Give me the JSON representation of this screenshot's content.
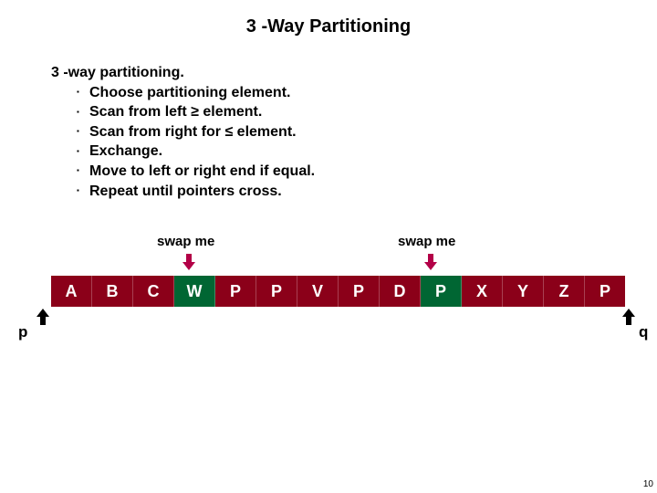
{
  "title": "3 -Way Partitioning",
  "heading": "3 -way partitioning.",
  "bullets": [
    "Choose partitioning element.",
    "Scan from left ≥ element.",
    "Scan from right for ≤  element.",
    "Exchange.",
    "Move to left or right end if equal.",
    "Repeat until pointers cross."
  ],
  "swap_left": "swap me",
  "swap_right": "swap me",
  "cells": [
    {
      "v": "A",
      "c": "red"
    },
    {
      "v": "B",
      "c": "red"
    },
    {
      "v": "C",
      "c": "red"
    },
    {
      "v": "W",
      "c": "green"
    },
    {
      "v": "P",
      "c": "red"
    },
    {
      "v": "P",
      "c": "red"
    },
    {
      "v": "V",
      "c": "red"
    },
    {
      "v": "P",
      "c": "red"
    },
    {
      "v": "D",
      "c": "red"
    },
    {
      "v": "P",
      "c": "green"
    },
    {
      "v": "X",
      "c": "red"
    },
    {
      "v": "Y",
      "c": "red"
    },
    {
      "v": "Z",
      "c": "red"
    },
    {
      "v": "P",
      "c": "red"
    }
  ],
  "ptr_left": "p",
  "ptr_right": "q",
  "pagenum": "10"
}
